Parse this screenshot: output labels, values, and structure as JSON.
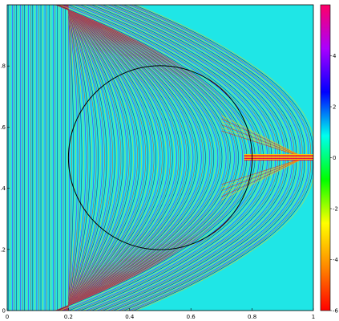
{
  "chart_data": {
    "type": "heatmap",
    "title": "",
    "xlabel": "",
    "ylabel": "",
    "xlim": [
      0,
      1
    ],
    "ylim": [
      0,
      1
    ],
    "x_ticks": [
      "0",
      "0.2",
      "0.4",
      "0.6",
      "0.8",
      "1"
    ],
    "x_tick_values": [
      0,
      0.2,
      0.4,
      0.6,
      0.8,
      1
    ],
    "y_ticks": [
      "0",
      "0.2",
      "0.4",
      "0.6",
      "0.8"
    ],
    "y_tick_values": [
      0,
      0.2,
      0.4,
      0.6,
      0.8
    ],
    "colorbar": {
      "range": [
        -6,
        6
      ],
      "ticks": [
        "4",
        "2",
        "0",
        "-2",
        "-4",
        "-6"
      ],
      "tick_values": [
        4,
        2,
        0,
        -2,
        -4,
        -6
      ],
      "colormap_stops": [
        "#ff0000",
        "#ff8800",
        "#ffff00",
        "#00ff00",
        "#00ffee",
        "#0000ff",
        "#aa00ff",
        "#ff0066"
      ]
    },
    "field": {
      "background_color": "#1fe6e6",
      "wave_direction": "+x",
      "peak_magnitude": 6
    },
    "lens_circle": {
      "center": [
        0.5,
        0.5
      ],
      "radius": 0.3,
      "line_color": "#000000"
    },
    "focus_point": [
      0.8,
      0.5
    ],
    "grid": false,
    "legend": "colorbar-right"
  }
}
